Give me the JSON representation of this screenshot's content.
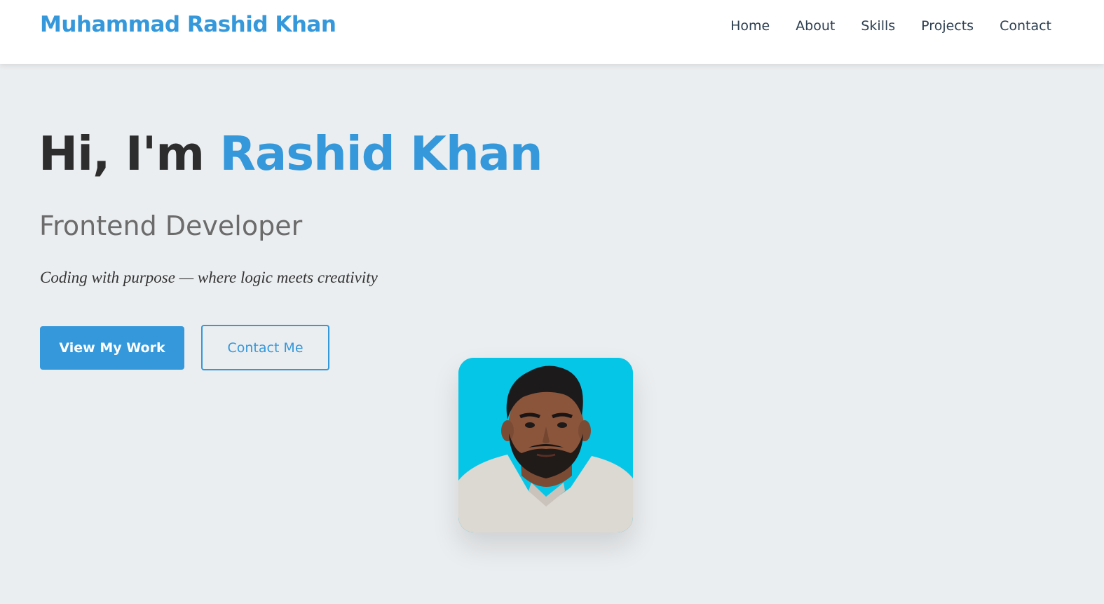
{
  "navbar": {
    "brand": "Muhammad Rashid Khan",
    "links": [
      {
        "label": "Home"
      },
      {
        "label": "About"
      },
      {
        "label": "Skills"
      },
      {
        "label": "Projects"
      },
      {
        "label": "Contact"
      }
    ]
  },
  "hero": {
    "greeting": "Hi, I'm",
    "name": "Rashid Khan",
    "subtitle": "Frontend Developer",
    "tagline": "Coding with purpose — where logic meets creativity",
    "primary_button": "View My Work",
    "secondary_button": "Contact Me"
  },
  "colors": {
    "accent": "#3498db",
    "background": "#ebeef0",
    "photo_background": "#06c6e8"
  }
}
